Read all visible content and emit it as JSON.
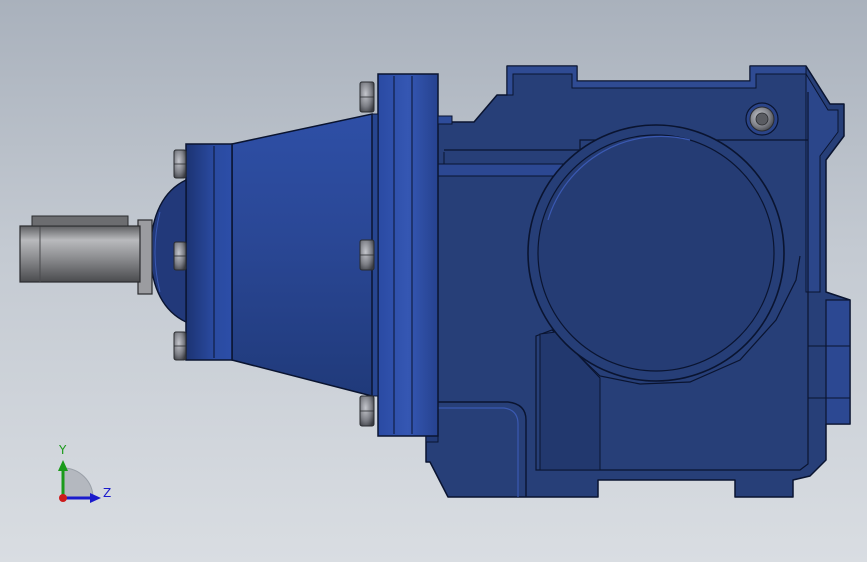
{
  "viewport": {
    "background_top": "#a9b1bc",
    "background_bottom": "#d9dde2"
  },
  "model": {
    "body_color": "#273f78",
    "highlight_color": "#3a59b2",
    "edge_color": "#0a1430",
    "shaft_color": "#8f9093",
    "bolt_color": "#7d7f86"
  },
  "triad": {
    "y_label": "Y",
    "z_label": "Z",
    "y_color": "#1a9a1a",
    "z_color": "#1a1acc",
    "x_color": "#cc1a1a"
  }
}
